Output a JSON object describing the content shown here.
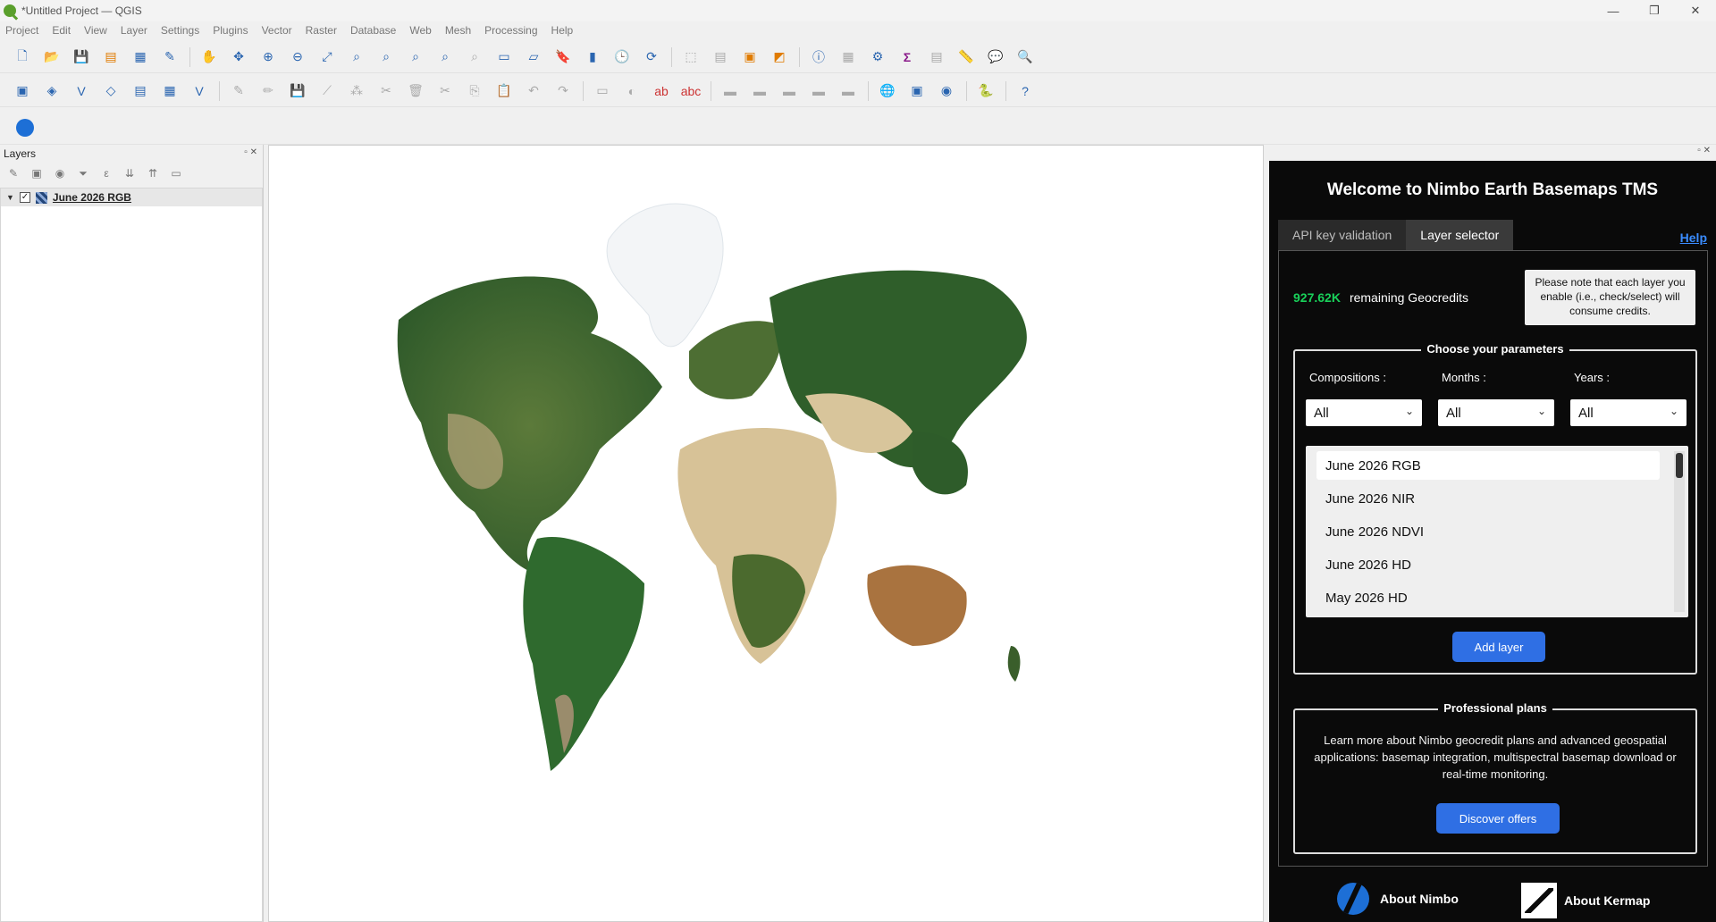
{
  "window": {
    "title": "*Untitled Project — QGIS",
    "controls": [
      "—",
      "❐",
      "✕"
    ]
  },
  "menu": [
    "Project",
    "Edit",
    "View",
    "Layer",
    "Settings",
    "Plugins",
    "Vector",
    "Raster",
    "Database",
    "Web",
    "Mesh",
    "Processing",
    "Help"
  ],
  "layers_panel": {
    "title": "Layers",
    "layers": [
      {
        "name": "June 2026 RGB",
        "checked": true
      }
    ]
  },
  "nimbo": {
    "title": "Welcome to Nimbo Earth Basemaps TMS",
    "tabs": [
      "API key validation",
      "Layer selector"
    ],
    "active_tab": "Layer selector",
    "help": "Help",
    "credits_value": "927.62K",
    "credits_label": "remaining Geocredits",
    "note": "Please note that each layer you enable (i.e., check/select) will consume credits.",
    "params_title": "Choose your parameters",
    "compositions_label": "Compositions :",
    "months_label": "Months :",
    "years_label": "Years :",
    "compositions_value": "All",
    "months_value": "All",
    "years_value": "All",
    "layer_list": [
      "June 2026 RGB",
      "June 2026 NIR",
      "June 2026 NDVI",
      "June 2026 HD",
      "May 2026 HD"
    ],
    "selected_layer": "June 2026 RGB",
    "add_layer": "Add layer",
    "plans_title": "Professional plans",
    "plans_text": "Learn more about Nimbo geocredit plans and advanced geospatial applications: basemap integration, multispectral basemap download or real-time monitoring.",
    "discover": "Discover offers",
    "about_nimbo": "About Nimbo",
    "about_kermap": "About Kermap"
  },
  "colors": {
    "credits": "#19d15a",
    "accent_button": "#2f6fe4",
    "help_link": "#3a8cff",
    "panel_bg": "#0a0a0a"
  }
}
